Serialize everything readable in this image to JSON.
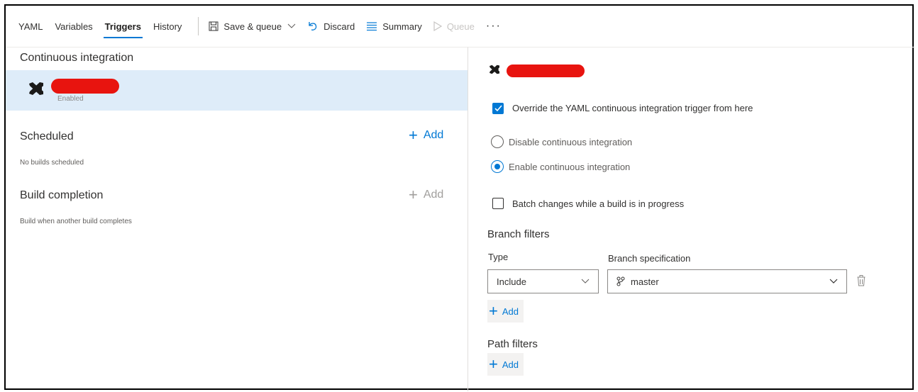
{
  "toolbar": {
    "tabs": [
      {
        "label": "YAML"
      },
      {
        "label": "Variables"
      },
      {
        "label": "Triggers"
      },
      {
        "label": "History"
      }
    ],
    "save_queue_label": "Save & queue",
    "discard_label": "Discard",
    "summary_label": "Summary",
    "queue_label": "Queue",
    "more_label": "···"
  },
  "left": {
    "ci_title": "Continuous integration",
    "ci_item_status": "Enabled",
    "scheduled_title": "Scheduled",
    "scheduled_add": "Add",
    "scheduled_note": "No builds scheduled",
    "build_completion_title": "Build completion",
    "build_completion_add": "Add",
    "build_completion_note": "Build when another build completes"
  },
  "right": {
    "override_label": "Override the YAML continuous integration trigger from here",
    "disable_ci_label": "Disable continuous integration",
    "enable_ci_label": "Enable continuous integration",
    "batch_label": "Batch changes while a build is in progress",
    "branch_filters_title": "Branch filters",
    "type_header": "Type",
    "branch_spec_header": "Branch specification",
    "type_value": "Include",
    "branch_value": "master",
    "branch_add": "Add",
    "path_filters_title": "Path filters",
    "path_add": "Add"
  },
  "colors": {
    "accent": "#0078d4",
    "selected_row": "#deecf9",
    "redaction": "#e8140f"
  }
}
